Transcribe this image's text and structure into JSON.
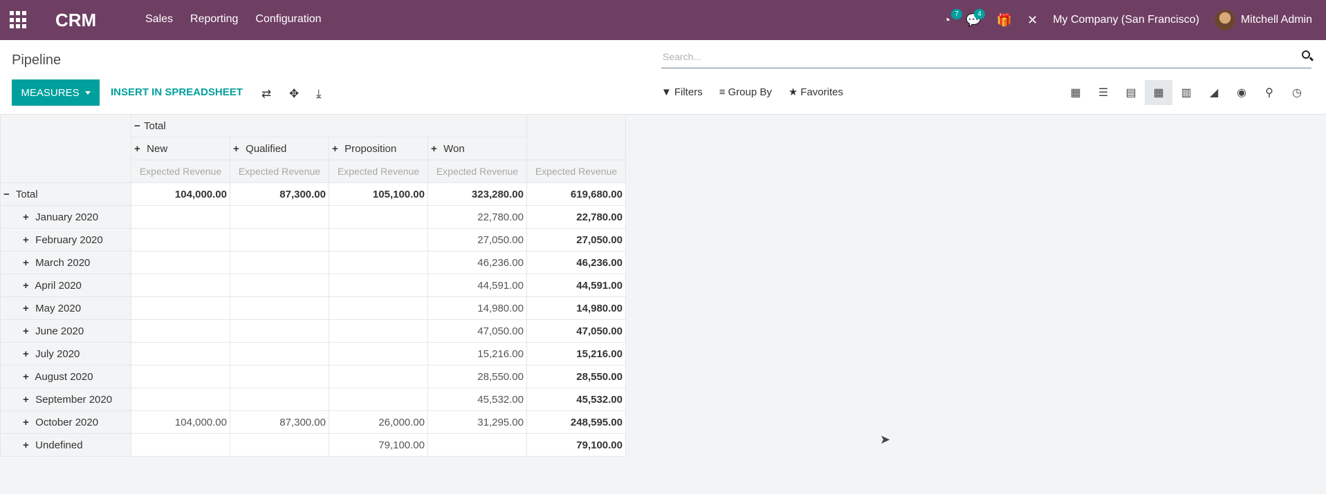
{
  "navbar": {
    "brand": "CRM",
    "menu": [
      "Sales",
      "Reporting",
      "Configuration"
    ],
    "activity_count": "7",
    "message_count": "4",
    "company": "My Company (San Francisco)",
    "user": "Mitchell Admin",
    "color": "#6f3f63"
  },
  "control": {
    "breadcrumb": "Pipeline",
    "search_placeholder": "Search...",
    "measures_label": "MEASURES",
    "insert_label": "INSERT IN SPREADSHEET",
    "filters_label": "Filters",
    "groupby_label": "Group By",
    "favorites_label": "Favorites",
    "accent": "#00a09d",
    "views": [
      "kanban-icon",
      "list-icon",
      "calendar-icon",
      "pivot-icon",
      "graph-icon",
      "cohort-icon",
      "dashboard-icon",
      "map-icon",
      "activity-icon"
    ],
    "active_view": "pivot-icon"
  },
  "pivot": {
    "col_total_label": "Total",
    "columns": [
      "New",
      "Qualified",
      "Proposition",
      "Won"
    ],
    "measure": "Expected Revenue",
    "total_row": {
      "label": "Total",
      "values": [
        "104,000.00",
        "87,300.00",
        "105,100.00",
        "323,280.00",
        "619,680.00"
      ]
    },
    "rows": [
      {
        "label": "January 2020",
        "values": [
          "",
          "",
          "",
          "22,780.00",
          "22,780.00"
        ]
      },
      {
        "label": "February 2020",
        "values": [
          "",
          "",
          "",
          "27,050.00",
          "27,050.00"
        ]
      },
      {
        "label": "March 2020",
        "values": [
          "",
          "",
          "",
          "46,236.00",
          "46,236.00"
        ]
      },
      {
        "label": "April 2020",
        "values": [
          "",
          "",
          "",
          "44,591.00",
          "44,591.00"
        ]
      },
      {
        "label": "May 2020",
        "values": [
          "",
          "",
          "",
          "14,980.00",
          "14,980.00"
        ]
      },
      {
        "label": "June 2020",
        "values": [
          "",
          "",
          "",
          "47,050.00",
          "47,050.00"
        ]
      },
      {
        "label": "July 2020",
        "values": [
          "",
          "",
          "",
          "15,216.00",
          "15,216.00"
        ]
      },
      {
        "label": "August 2020",
        "values": [
          "",
          "",
          "",
          "28,550.00",
          "28,550.00"
        ]
      },
      {
        "label": "September 2020",
        "values": [
          "",
          "",
          "",
          "45,532.00",
          "45,532.00"
        ]
      },
      {
        "label": "October 2020",
        "values": [
          "104,000.00",
          "87,300.00",
          "26,000.00",
          "31,295.00",
          "248,595.00"
        ]
      },
      {
        "label": "Undefined",
        "values": [
          "",
          "",
          "79,100.00",
          "",
          "79,100.00"
        ]
      }
    ]
  }
}
